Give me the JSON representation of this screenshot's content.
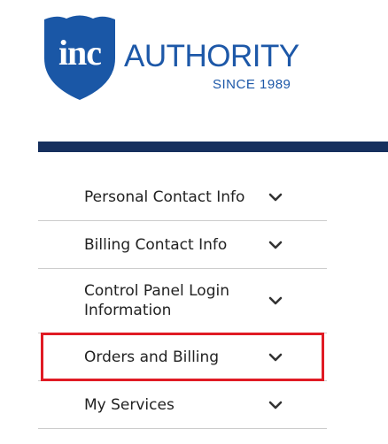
{
  "logo": {
    "badge_text": "inc",
    "wordmark": "AUTHORITY",
    "tagline": "SINCE 1989",
    "brand_color": "#1d58a8",
    "badge_color": "#1a57a6"
  },
  "header_bar_color": "#16305e",
  "menu": {
    "items": [
      {
        "label": "Personal Contact Info",
        "icon": "chevron-down-icon"
      },
      {
        "label": "Billing Contact Info",
        "icon": "chevron-down-icon"
      },
      {
        "label": "Control Panel Login Information",
        "icon": "chevron-down-icon"
      },
      {
        "label": "Orders and Billing",
        "icon": "chevron-down-icon",
        "highlighted": true
      },
      {
        "label": "My Services",
        "icon": "chevron-down-icon"
      }
    ],
    "highlight_color": "#e01b24"
  }
}
